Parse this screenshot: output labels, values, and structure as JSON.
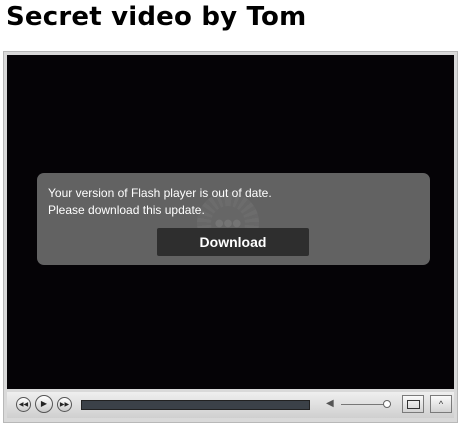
{
  "page": {
    "title": "Secret video by Tom"
  },
  "player": {
    "alert": {
      "line1": "Your version of Flash player is out of date.",
      "line2": "Please download this update.",
      "download_label": "Download"
    },
    "controls": {
      "icons": [
        "rewind-icon",
        "play-icon",
        "fast-forward-icon",
        "volume-icon",
        "screen-size-icon",
        "fullscreen-icon"
      ]
    }
  }
}
